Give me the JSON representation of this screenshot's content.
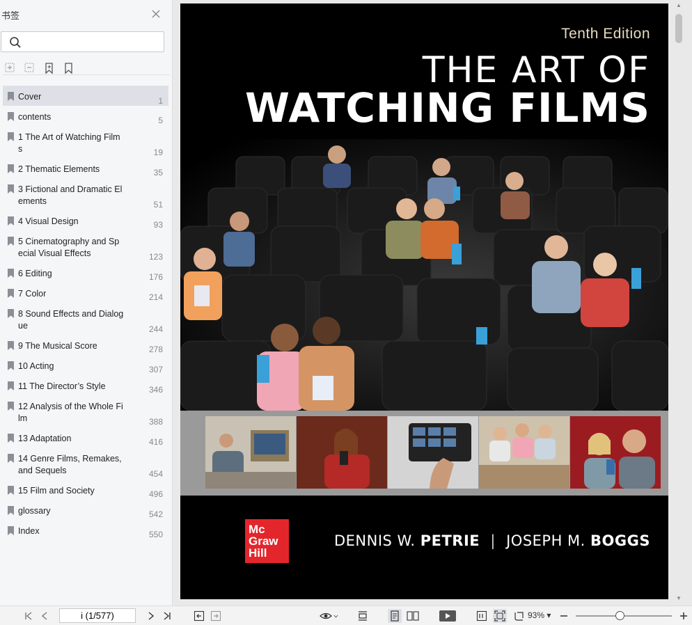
{
  "sidebar": {
    "title": "书签",
    "search_placeholder": "",
    "tools": [
      "expand-all-icon",
      "collapse-all-icon",
      "add-bookmark-icon",
      "bookmark-icon"
    ],
    "bookmarks": [
      {
        "label": "Cover",
        "page": "1",
        "selected": true
      },
      {
        "label": "contents",
        "page": "5"
      },
      {
        "label": "1 The Art of Watching Films",
        "page": "19"
      },
      {
        "label": "2 Thematic Elements",
        "page": "35"
      },
      {
        "label": "3 Fictional and Dramatic Elements",
        "page": "51"
      },
      {
        "label": "4 Visual Design",
        "page": "93"
      },
      {
        "label": "5 Cinematography and Special Visual Effects",
        "page": "123"
      },
      {
        "label": "6 Editing",
        "page": "176"
      },
      {
        "label": "7 Color",
        "page": "214"
      },
      {
        "label": "8 Sound Effects and Dialogue",
        "page": "244"
      },
      {
        "label": "9 The Musical Score",
        "page": "278"
      },
      {
        "label": "10 Acting",
        "page": "307"
      },
      {
        "label": "11 The Director’s Style",
        "page": "346"
      },
      {
        "label": "12 Analysis of the Whole Film",
        "page": "388"
      },
      {
        "label": "13 Adaptation",
        "page": "416"
      },
      {
        "label": "14 Genre Films, Remakes, and Sequels",
        "page": "454"
      },
      {
        "label": "15 Film and Society",
        "page": "496"
      },
      {
        "label": "glossary",
        "page": "542"
      },
      {
        "label": "Index",
        "page": "550"
      }
    ]
  },
  "cover": {
    "edition": "Tenth Edition",
    "title_line1": "THE ART OF",
    "title_line2": "WATCHING FILMS",
    "publisher_logo": [
      "Mc",
      "Graw",
      "Hill"
    ],
    "author1_first": "DENNIS W.",
    "author1_last": "PETRIE",
    "author2_first": "JOSEPH M.",
    "author2_last": "BOGGS"
  },
  "toolbar": {
    "page_indicator": "i (1/577)",
    "zoom": "93%"
  },
  "colors": {
    "accent_red": "#e3262b",
    "edition_gold": "#e8dcbc",
    "selected_bg": "#dde1e7"
  }
}
